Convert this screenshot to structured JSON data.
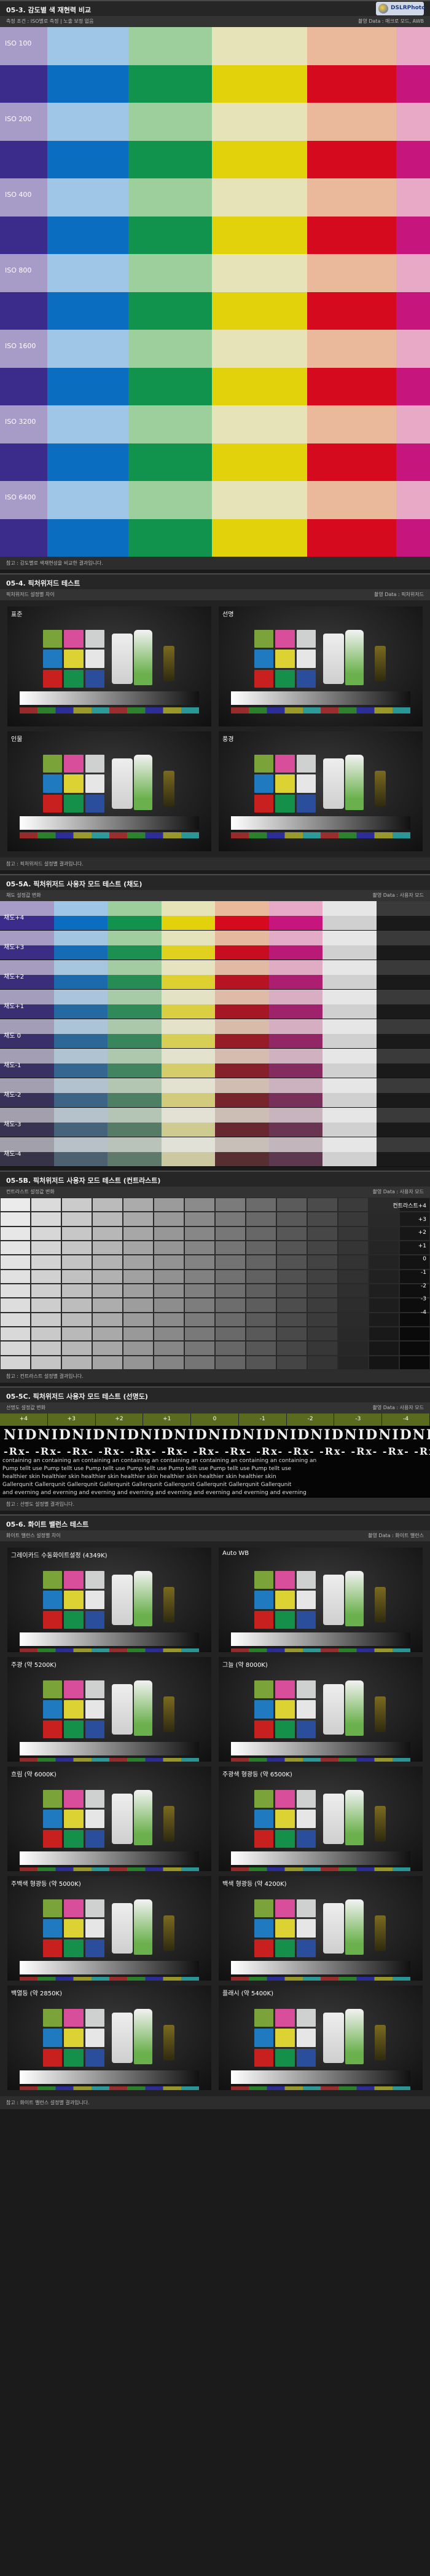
{
  "colors": {
    "light_purple": "#a79bc7",
    "light_blue": "#9fc6e6",
    "light_green": "#9ccf9b",
    "light_yellow": "#e6e3b8",
    "light_peach": "#eab89b",
    "light_pink": "#e8a9c6",
    "purple": "#3b2c8c",
    "blue": "#0b6dbf",
    "green": "#12934d",
    "yellow": "#e2d20b",
    "red": "#d60a1e",
    "magenta": "#c6157c"
  },
  "s1": {
    "title": "05-3. 감도별 색 재현력 비교",
    "desc": "측정 조건 : ISO별로 측정 | 노출 보정 없음",
    "meta": "촬영 Data : 매크로 모드, AWB",
    "rows": [
      "ISO 100",
      "ISO 200",
      "ISO 400",
      "ISO 800",
      "ISO 1600",
      "ISO 3200",
      "ISO 6400"
    ],
    "note": "참고 : 감도별로 색재현성을 비교한 결과입니다.",
    "logo": "DSLRPhoto"
  },
  "s2": {
    "title": "05-4. 픽처위저드 테스트",
    "desc": "픽처위저드 설정별 차이",
    "meta": "촬영 Data : 픽처위저드",
    "scenes": [
      "표준",
      "선명",
      "인물",
      "풍경"
    ],
    "note": "참고 : 픽처위저드 설정별 결과입니다."
  },
  "s3": {
    "title": "05-5A. 픽처위저드 사용자 모드 테스트 (채도)",
    "desc": "채도 설정값 변화",
    "meta": "촬영 Data : 사용자 모드",
    "rows": [
      "채도+4",
      "채도+3",
      "채도+2",
      "채도+1",
      "채도 0",
      "채도-1",
      "채도-2",
      "채도-3",
      "채도-4"
    ]
  },
  "s4": {
    "title": "05-5B. 픽처위저드 사용자 모드 테스트 (컨트라스트)",
    "desc": "컨트라스트 설정값 변화",
    "meta": "촬영 Data : 사용자 모드",
    "head": "컨트라스트+4",
    "levels": [
      "+3",
      "+2",
      "+1",
      "0",
      "-1",
      "-2",
      "-3",
      "-4"
    ],
    "note": "참고 : 컨트라스트 설정별 결과입니다."
  },
  "s5": {
    "title": "05-5C. 픽처위저드 사용자 모드 테스트 (선명도)",
    "desc": "선명도 설정값 변화",
    "meta": "촬영 Data : 사용자 모드",
    "levels": [
      "+4",
      "+3",
      "+2",
      "+1",
      "0",
      "-1",
      "-2",
      "-3",
      "-4"
    ],
    "big": "NIDNIDNIDNIDNIDNIDNIDNIDNIDNIDNIDNIDNIDNIDNIDNIDNIDNIDNIDNIDNIDNIDNIDNIDNIDNIDNIDNIDNIDNIDNIDNIDNIDNIDNIDNIDNIDNIDNIDNIDNIDNIDNIDNIDNIDNIDNIDNIDNIDNIDNIDNIDNIDNIDNIDNIDNIDNIDNIDNIDNIDNIDNIDNIDNIDNIDNIDNIDNIDNIDNIDNIDNIDNIDNIDNIDNIDNIDNIDNID",
    "rx": "-Rx- -Rx- -Rx- -Rx- -Rx- -Rx- -Rx- -Rx- -Rx- -Rx- -Rx- -Rx- -Rx- -Rx-",
    "small": "containing an containing an containing an containing an containing an containing an containing an containing an",
    "small2": "Pump tellt use Pump tellt use Pump tellt use Pump tellt use Pump tellt use Pump tellt use Pump tellt use",
    "small3": "healthier skin healthier skin healthier skin healthier skin healthier skin healthier skin healthier skin",
    "small4": "Gallerqunit Gallerqunit Gallerqunit Gallerqunit Gallerqunit Gallerqunit Gallerqunit Gallerqunit Gallerqunit",
    "small5": "and everning and everning and everning and everning and everning and everning and everning and everning",
    "note": "참고 : 선명도 설정별 결과입니다."
  },
  "s6": {
    "title": "05-6. 화이트 밸런스 테스트",
    "desc": "화이트 밸런스 설정별 차이",
    "meta": "촬영 Data : 화이트 밸런스",
    "scenes": [
      "그레이카드 수동화이트설정 (4349K)",
      "Auto WB",
      "주광 (약 5200K)",
      "그늘 (약 8000K)",
      "흐림 (약 6000K)",
      "주광색 형광등 (약 6500K)",
      "주백색 형광등 (약 5000K)",
      "백색 형광등 (약 4200K)",
      "백열등 (약 2850K)",
      "플래시 (약 5400K)"
    ],
    "note": "참고 : 화이트 밸런스 설정별 결과입니다."
  }
}
